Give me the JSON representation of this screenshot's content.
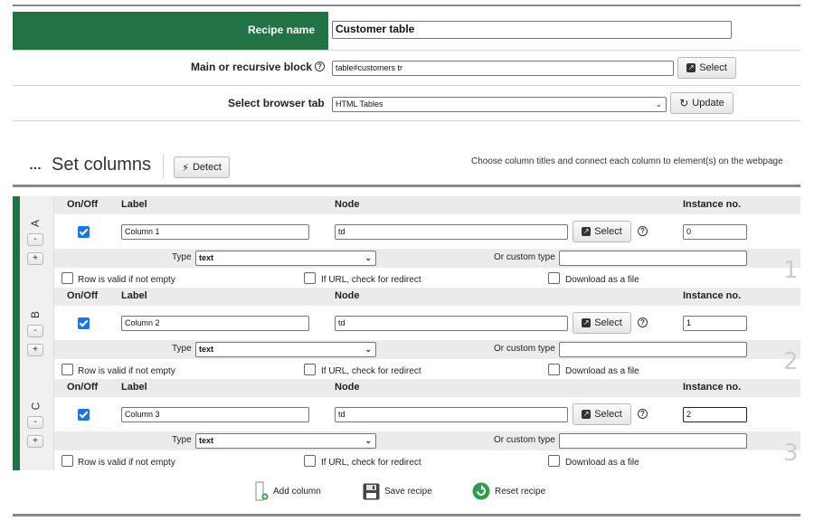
{
  "recipe": {
    "name_label": "Recipe name",
    "name_value": "Customer table",
    "main_block_label": "Main or recursive block",
    "main_block_value": "table#customers tr",
    "select_label": "Select",
    "browser_tab_label": "Select browser tab",
    "browser_tab_value": "HTML Tables",
    "update_label": "Update",
    "brand_color": "#217346"
  },
  "columns_section": {
    "menu_glyph": "…",
    "title": "Set columns",
    "detect_label": "Detect",
    "hint": "Choose column titles and connect each column to element(s) on the webpage"
  },
  "headers": {
    "onoff": "On/Off",
    "label": "Label",
    "node": "Node",
    "instance": "Instance no."
  },
  "row_labels": {
    "type": "Type",
    "custom_type": "Or custom type",
    "valid_if_not_empty": "Row is valid if not empty",
    "url_redirect": "If URL, check for redirect",
    "download_file": "Download as a file",
    "select": "Select",
    "minus": "-",
    "plus": "+"
  },
  "columns": [
    {
      "letter": "A",
      "number": "1",
      "enabled": true,
      "label": "Column 1",
      "node": "td",
      "type": "text",
      "custom_type": "",
      "instance": "0"
    },
    {
      "letter": "B",
      "number": "2",
      "enabled": true,
      "label": "Column 2",
      "node": "td",
      "type": "text",
      "custom_type": "",
      "instance": "1"
    },
    {
      "letter": "C",
      "number": "3",
      "enabled": true,
      "label": "Column 3",
      "node": "td",
      "type": "text",
      "custom_type": "",
      "instance": "2"
    }
  ],
  "footer": {
    "add_column": "Add column",
    "save_recipe": "Save recipe",
    "reset_recipe": "Reset recipe"
  }
}
